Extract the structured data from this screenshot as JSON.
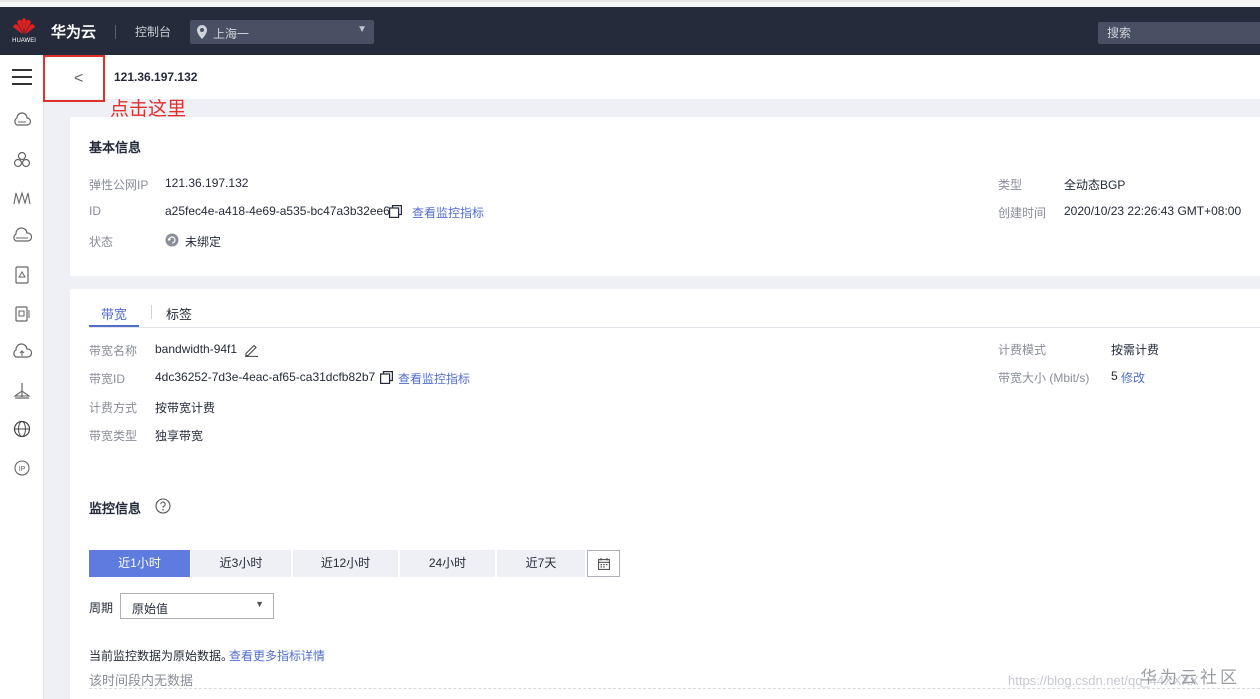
{
  "topbar": {
    "logo_text": "HUAWEI",
    "brand": "华为云",
    "console": "控制台",
    "region": "上海一",
    "search_placeholder": "搜索"
  },
  "header": {
    "ip_title": "121.36.197.132",
    "annotation": "点击这里"
  },
  "basic": {
    "title": "基本信息",
    "eip_label": "弹性公网IP",
    "eip_value": "121.36.197.132",
    "id_label": "ID",
    "id_value": "a25fec4e-a418-4e69-a535-bc47a3b32ee6",
    "id_link": "查看监控指标",
    "status_label": "状态",
    "status_value": "未绑定",
    "type_label": "类型",
    "type_value": "全动态BGP",
    "created_label": "创建时间",
    "created_value": "2020/10/23 22:26:43 GMT+08:00"
  },
  "tabs": {
    "bandwidth": "带宽",
    "tags": "标签"
  },
  "bandwidth": {
    "name_label": "带宽名称",
    "name_value": "bandwidth-94f1",
    "id_label": "带宽ID",
    "id_value": "4dc36252-7d3e-4eac-af65-ca31dcfb82b7",
    "id_link": "查看监控指标",
    "billing_method_label": "计费方式",
    "billing_method_value": "按带宽计费",
    "type_label": "带宽类型",
    "type_value": "独享带宽",
    "billing_mode_label": "计费模式",
    "billing_mode_value": "按需计费",
    "size_label": "带宽大小 (Mbit/s)",
    "size_value": "5",
    "size_link": "修改"
  },
  "monitor": {
    "title": "监控信息",
    "ranges": [
      "近1小时",
      "近3小时",
      "近12小时",
      "24小时",
      "近7天"
    ],
    "period_label": "周期",
    "period_value": "原始值",
    "note": "当前监控数据为原始数据。",
    "note_link": "查看更多指标详情",
    "empty": "该时间段内无数据"
  },
  "watermark": {
    "url": "https://blog.csdn.net/qq_44XXXX",
    "community": "华为云社区"
  },
  "colors": {
    "topbar": "#252b3a",
    "accent": "#526ecc",
    "active_button": "#5e7ce0",
    "annotation": "#e0302a"
  }
}
